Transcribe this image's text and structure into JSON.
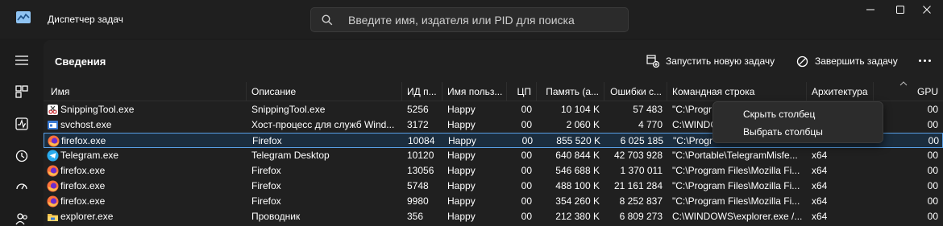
{
  "window": {
    "title": "Диспетчер задач"
  },
  "search": {
    "placeholder": "Введите имя, издателя или PID для поиска"
  },
  "page": {
    "title": "Сведения"
  },
  "toolbar": {
    "run_task": "Запустить новую задачу",
    "end_task": "Завершить задачу"
  },
  "columns": [
    "Имя",
    "Описание",
    "ИД п...",
    "Имя польз...",
    "ЦП",
    "Память (а...",
    "Ошибки с...",
    "Командная строка",
    "Архитектура",
    "GPU"
  ],
  "rows": [
    {
      "name": "SnippingTool.exe",
      "icon": "snipping-tool-icon",
      "desc": "SnippingTool.exe",
      "pid": "5256",
      "user": "Happy",
      "cpu": "00",
      "mem": "10 104 K",
      "faults": "57 483",
      "cmd": "\"C:\\Progr",
      "arch": "",
      "gpu": "00",
      "selected": false
    },
    {
      "name": "svchost.exe",
      "icon": "service-host-icon",
      "desc": "Хост-процесс для служб Wind...",
      "pid": "3172",
      "user": "Happy",
      "cpu": "00",
      "mem": "2 060 K",
      "faults": "4 770",
      "cmd": "C:\\WINDO",
      "arch": "",
      "gpu": "00",
      "selected": false
    },
    {
      "name": "firefox.exe",
      "icon": "firefox-icon",
      "desc": "Firefox",
      "pid": "10084",
      "user": "Happy",
      "cpu": "00",
      "mem": "855 520 K",
      "faults": "6 025 185",
      "cmd": "\"C:\\Progr",
      "arch": "",
      "gpu": "00",
      "selected": true
    },
    {
      "name": "Telegram.exe",
      "icon": "telegram-icon",
      "desc": "Telegram Desktop",
      "pid": "10120",
      "user": "Happy",
      "cpu": "00",
      "mem": "640 844 K",
      "faults": "42 703 928",
      "cmd": "\"C:\\Portable\\TelegramMisfe...",
      "arch": "x64",
      "gpu": "00",
      "selected": false
    },
    {
      "name": "firefox.exe",
      "icon": "firefox-icon",
      "desc": "Firefox",
      "pid": "13056",
      "user": "Happy",
      "cpu": "00",
      "mem": "546 688 K",
      "faults": "1 370 011",
      "cmd": "\"C:\\Program Files\\Mozilla Fi...",
      "arch": "x64",
      "gpu": "00",
      "selected": false
    },
    {
      "name": "firefox.exe",
      "icon": "firefox-icon",
      "desc": "Firefox",
      "pid": "5748",
      "user": "Happy",
      "cpu": "00",
      "mem": "488 100 K",
      "faults": "21 161 284",
      "cmd": "\"C:\\Program Files\\Mozilla Fi...",
      "arch": "x64",
      "gpu": "00",
      "selected": false
    },
    {
      "name": "firefox.exe",
      "icon": "firefox-icon",
      "desc": "Firefox",
      "pid": "9980",
      "user": "Happy",
      "cpu": "00",
      "mem": "354 260 K",
      "faults": "8 252 837",
      "cmd": "\"C:\\Program Files\\Mozilla Fi...",
      "arch": "x64",
      "gpu": "00",
      "selected": false
    },
    {
      "name": "explorer.exe",
      "icon": "explorer-icon",
      "desc": "Проводник",
      "pid": "356",
      "user": "Happy",
      "cpu": "00",
      "mem": "212 380 K",
      "faults": "6 809 273",
      "cmd": "C:\\WINDOWS\\explorer.exe /...",
      "arch": "x64",
      "gpu": "00",
      "selected": false
    }
  ],
  "context_menu": {
    "hide_column": "Скрыть столбец",
    "select_columns": "Выбрать столбцы"
  },
  "colors": {
    "accent": "#5aa0e6",
    "selection_bg": "#1b2d3e",
    "panel_bg": "#202020",
    "titlebar_bg": "#1f1f1f"
  }
}
